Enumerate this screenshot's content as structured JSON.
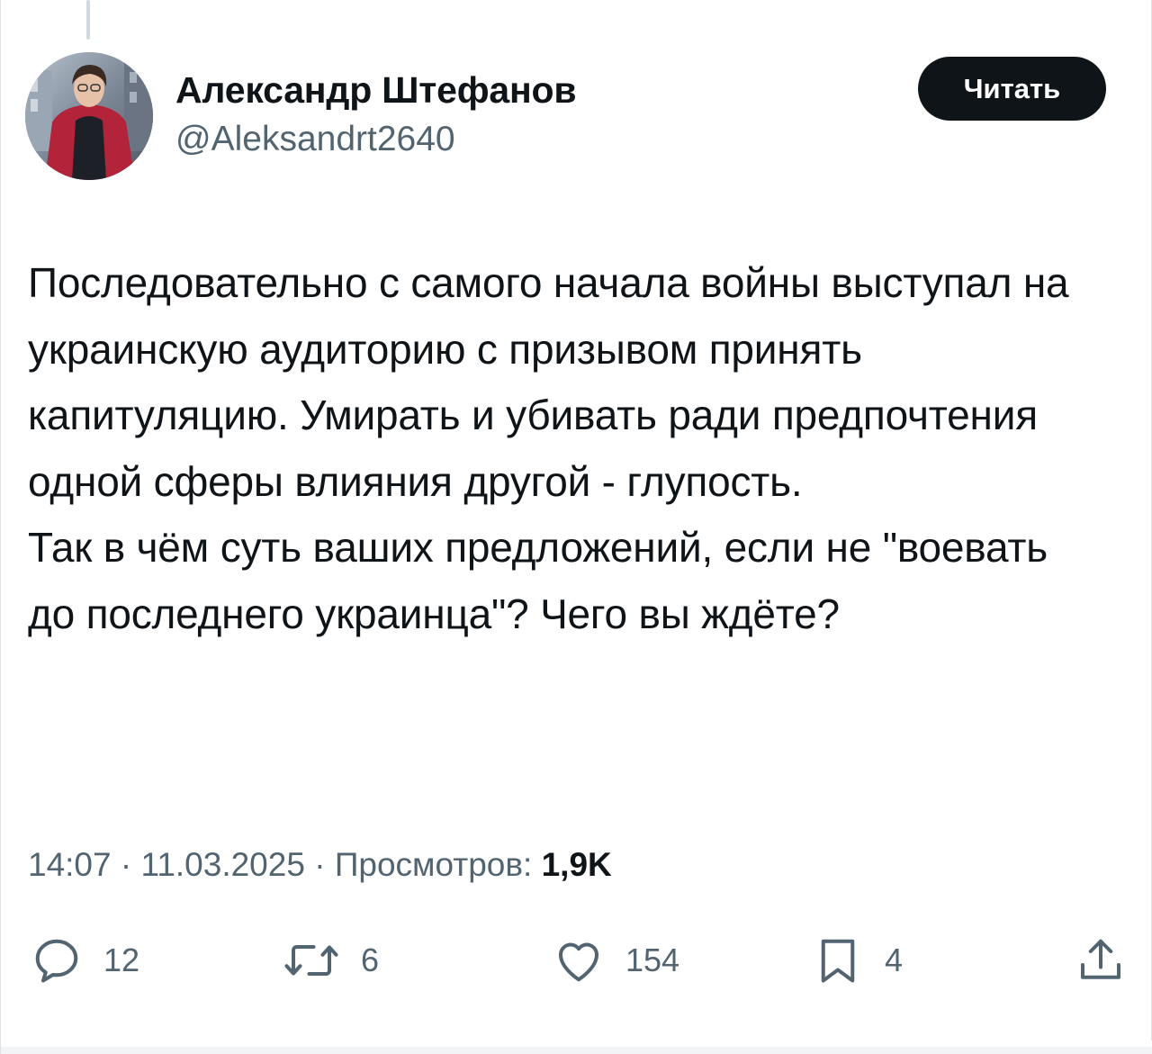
{
  "author": {
    "display_name": "Александр Штефанов",
    "handle": "@Aleksandrt2640",
    "avatar_icon": "user-photo-avatar"
  },
  "follow_button": {
    "label": "Читать"
  },
  "tweet": {
    "text": "Последовательно с самого начала войны выступал на украинскую аудиторию с призывом принять капитуляцию. Умирать и убивать ради предпочтения одной сферы влияния другой - глупость.\nТак в чём суть ваших предложений, если не \"воевать до последнего украинца\"? Чего вы ждёте?",
    "time": "14:07",
    "date": "11.03.2025",
    "views_label": "Просмотров:",
    "views_count": "1,9K",
    "separator": "·"
  },
  "actions": {
    "reply": {
      "icon": "reply-bubble-icon",
      "count": "12"
    },
    "retweet": {
      "icon": "retweet-icon",
      "count": "6"
    },
    "like": {
      "icon": "heart-icon",
      "count": "154"
    },
    "bookmark": {
      "icon": "bookmark-icon",
      "count": "4"
    },
    "share": {
      "icon": "share-icon"
    }
  },
  "colors": {
    "text_primary": "#0f1419",
    "text_secondary": "#536471",
    "button_bg": "#0f1419",
    "button_text": "#ffffff",
    "thread_line": "#cfd9de"
  }
}
